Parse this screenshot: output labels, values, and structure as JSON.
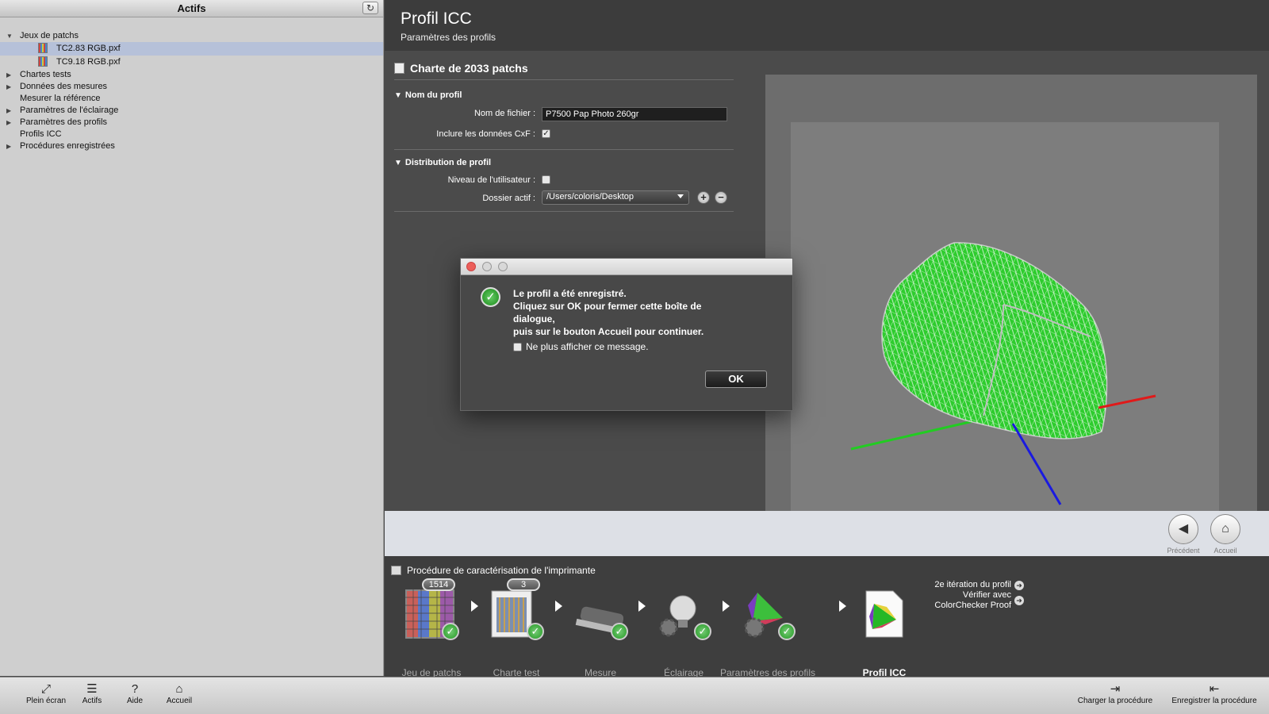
{
  "sidebar": {
    "title": "Actifs",
    "refresh_icon": "refresh-icon",
    "tree": [
      {
        "label": "Jeux de patchs",
        "expanded": true
      },
      {
        "label": "TC2.83 RGB.pxf",
        "selected": true
      },
      {
        "label": "TC9.18 RGB.pxf"
      },
      {
        "label": "Chartes tests"
      },
      {
        "label": "Données des mesures"
      },
      {
        "label": "Mesurer la référence"
      },
      {
        "label": "Paramètres de l'éclairage"
      },
      {
        "label": "Paramètres des profils"
      },
      {
        "label": "Profils ICC"
      },
      {
        "label": "Procédures enregistrées"
      }
    ]
  },
  "header": {
    "title": "Profil ICC",
    "subtitle": "Paramètres des profils"
  },
  "form": {
    "chart_title": "Charte de 2033 patchs",
    "section_profile_name": "Nom du profil",
    "filename_label": "Nom de fichier :",
    "filename_value": "P7500 Pap Photo 260gr",
    "include_cxf_label": "Inclure les données CxF :",
    "include_cxf_checked": true,
    "section_distribution": "Distribution de profil",
    "user_level_label": "Niveau de l'utilisateur :",
    "user_level_checked": false,
    "active_folder_label": "Dossier actif :",
    "active_folder_value": "/Users/coloris/Desktop"
  },
  "nav": {
    "previous_label": "Précédent",
    "home_label": "Accueil"
  },
  "procedure": {
    "title": "Procédure de caractérisation de l'imprimante",
    "steps": [
      {
        "label": "Jeu de patchs",
        "badge": "1514",
        "done": true
      },
      {
        "label": "Charte test",
        "badge": "3",
        "done": true
      },
      {
        "label": "Mesure",
        "done": true
      },
      {
        "label": "Éclairage",
        "done": true
      },
      {
        "label": "Paramètres des profils",
        "done": true
      },
      {
        "label": "Profil ICC",
        "active": true
      }
    ],
    "next_links": [
      "2e itération du profil",
      "Vérifier avec ColorChecker Proof"
    ]
  },
  "toolbar": {
    "fullscreen": "Plein écran",
    "assets": "Actifs",
    "help": "Aide",
    "home": "Accueil",
    "load_procedure": "Charger la procédure",
    "save_procedure": "Enregistrer la procédure"
  },
  "dialog": {
    "message_lines": [
      "Le profil a été enregistré.",
      "Cliquez sur OK pour fermer cette boîte de dialogue,",
      "puis sur le bouton Accueil pour continuer."
    ],
    "checkbox_label": "Ne plus afficher ce message.",
    "checkbox_checked": false,
    "ok_label": "OK"
  },
  "colors": {
    "gamut_fill": "#2ecc2e",
    "axis_x": "#e01a1a",
    "axis_y": "#22cc22",
    "axis_z": "#1a1ae0"
  }
}
